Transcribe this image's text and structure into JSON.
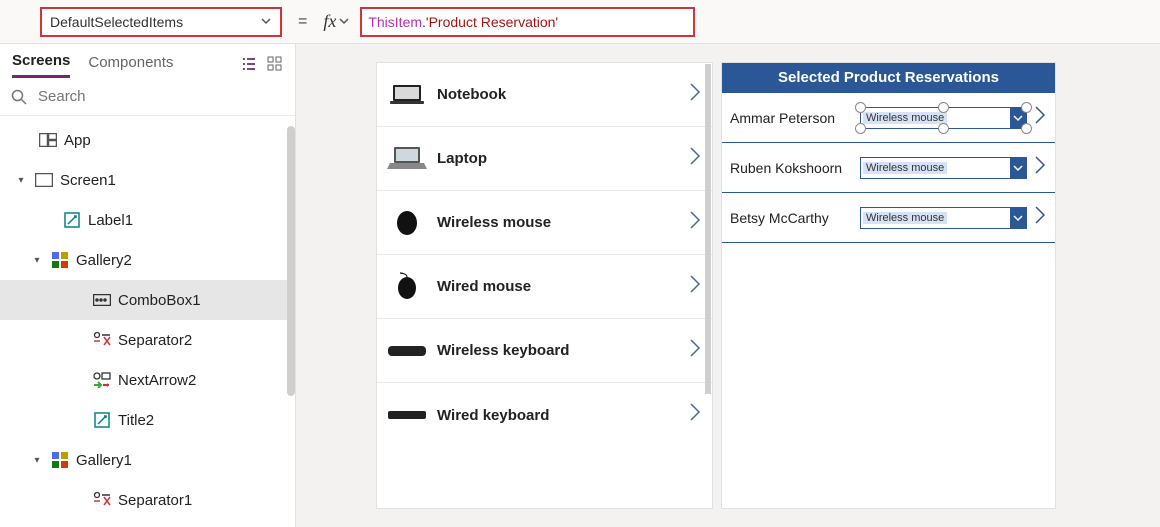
{
  "formula_bar": {
    "property": "DefaultSelectedItems",
    "equals": "=",
    "fx_label": "fx",
    "formula_prefix": "ThisItem",
    "formula_dot": ".",
    "formula_string": "'Product Reservation'"
  },
  "left_panel": {
    "tabs": {
      "screens": "Screens",
      "components": "Components"
    },
    "search_placeholder": "Search",
    "tree": {
      "app": "App",
      "screen1": "Screen1",
      "label1": "Label1",
      "gallery2": "Gallery2",
      "combobox1": "ComboBox1",
      "separator2": "Separator2",
      "nextarrow2": "NextArrow2",
      "title2": "Title2",
      "gallery1": "Gallery1",
      "separator1": "Separator1"
    }
  },
  "canvas": {
    "products": [
      {
        "name": "Notebook"
      },
      {
        "name": "Laptop"
      },
      {
        "name": "Wireless mouse"
      },
      {
        "name": "Wired mouse"
      },
      {
        "name": "Wireless keyboard"
      },
      {
        "name": "Wired keyboard"
      }
    ],
    "reservations_header": "Selected Product Reservations",
    "reservations": [
      {
        "who": "Ammar Peterson",
        "value": "Wireless mouse"
      },
      {
        "who": "Ruben Kokshoorn",
        "value": "Wireless mouse"
      },
      {
        "who": "Betsy McCarthy",
        "value": "Wireless mouse"
      }
    ]
  },
  "colors": {
    "accent": "#2b5797",
    "highlight_border": "#d13438",
    "tab_underline": "#742774"
  }
}
